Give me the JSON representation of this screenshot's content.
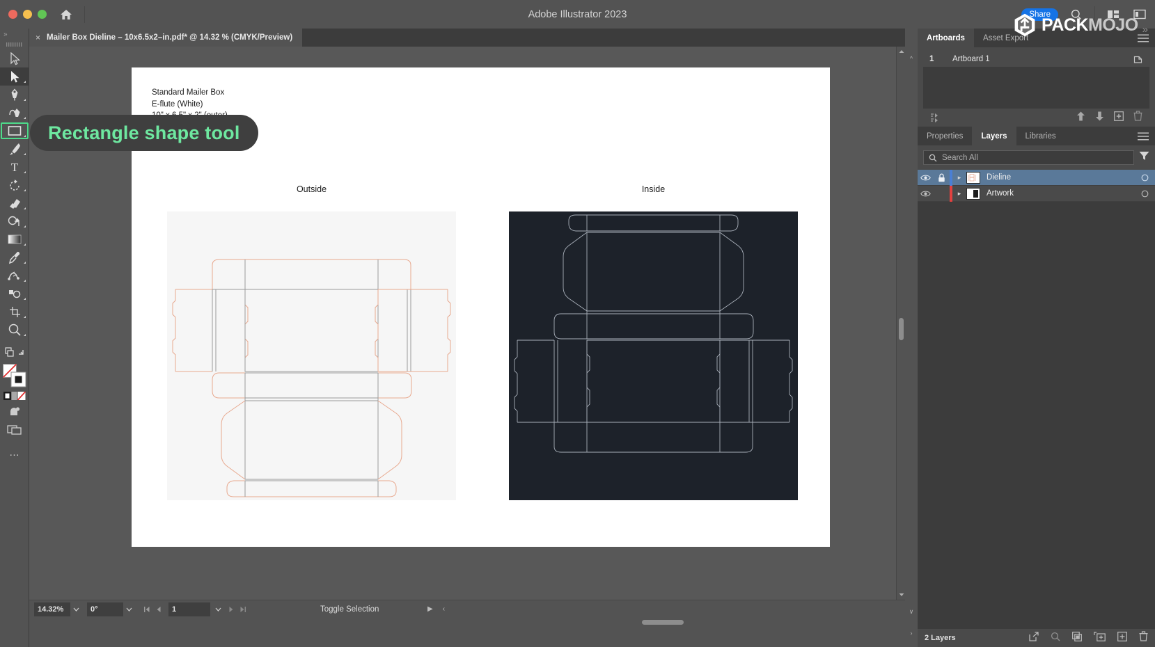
{
  "window": {
    "app_title": "Adobe Illustrator 2023",
    "traffic_lights": [
      "close-red",
      "minimize-yellow",
      "maximize-green"
    ],
    "home_icon": "home-icon",
    "share_label": "Share",
    "search_icon": "search-icon",
    "arrange_icon": "arrange-documents-icon",
    "workspace_icon": "workspace-switcher-icon"
  },
  "branding": {
    "logo_icon": "packmojo-cube-logo",
    "name_part1": "PACK",
    "name_part2": "MOJO",
    "trailing": "»"
  },
  "toolbar": {
    "collapse_label": "»",
    "tools": [
      {
        "name": "selection-tool",
        "icon": "arrow-outline-icon",
        "state": "normal"
      },
      {
        "name": "direct-selection-tool",
        "icon": "arrow-solid-icon",
        "state": "active"
      },
      {
        "name": "pen-tool",
        "icon": "pen-icon",
        "state": "normal"
      },
      {
        "name": "curvature-tool",
        "icon": "curvature-icon",
        "state": "normal"
      },
      {
        "name": "rectangle-shape-tool",
        "icon": "rectangle-icon",
        "state": "highlighted"
      },
      {
        "name": "paintbrush-tool",
        "icon": "paintbrush-icon",
        "state": "normal"
      },
      {
        "name": "type-tool",
        "icon": "type-T-icon",
        "state": "normal"
      },
      {
        "name": "rotate-tool",
        "icon": "rotate-icon",
        "state": "normal"
      },
      {
        "name": "eraser-tool",
        "icon": "eraser-icon",
        "state": "normal"
      },
      {
        "name": "shape-builder-tool",
        "icon": "shape-builder-icon",
        "state": "normal"
      },
      {
        "name": "gradient-tool",
        "icon": "gradient-icon",
        "state": "normal"
      },
      {
        "name": "eyedropper-tool",
        "icon": "eyedropper-icon",
        "state": "normal"
      },
      {
        "name": "blend-tool",
        "icon": "blend-icon",
        "state": "normal"
      },
      {
        "name": "symbol-sprayer-tool",
        "icon": "symbol-sprayer-icon",
        "state": "normal"
      },
      {
        "name": "artboard-tool",
        "icon": "artboard-icon",
        "state": "normal"
      },
      {
        "name": "zoom-tool",
        "icon": "magnifier-icon",
        "state": "normal"
      },
      {
        "name": "change-screen-mode",
        "icon": "screen-mode-icon",
        "state": "normal"
      },
      {
        "name": "edit-toolbar",
        "icon": "ellipsis-icon",
        "state": "normal"
      }
    ],
    "fill_stroke": {
      "fill_label": "none-fill",
      "stroke_label": "black-stroke",
      "color_mode_icons": [
        "color-swatch-icon",
        "gradient-swatch-icon",
        "none-swatch-icon"
      ]
    }
  },
  "tooltip": {
    "text": "Rectangle shape tool",
    "color": "#6ee8a0"
  },
  "document": {
    "tab_title": "Mailer Box Dieline – 10x6.5x2–in.pdf* @ 14.32 % (CMYK/Preview)",
    "tab_close": "×",
    "artboard_text": "Standard Mailer Box\nE-flute (White)\n10\" x 6.5\" x 2\" (outer)",
    "outside_label": "Outside",
    "inside_label": "Inside",
    "dieline_cut_color": "#e8a98f",
    "dieline_crease_color": "#9a9a9a",
    "inside_bg_color": "#1d222a",
    "inside_line_color": "#a9b0ba",
    "outside_bg_color": "#f6f6f6"
  },
  "statusbar": {
    "zoom_value": "14.32%",
    "rotation_value": "0°",
    "page_value": "1",
    "status_text": "Toggle Selection",
    "first_icon": "first-artboard-icon",
    "prev_icon": "previous-artboard-icon",
    "next_icon": "next-artboard-icon",
    "last_icon": "last-artboard-icon",
    "play_icon": "play-icon",
    "back_icon": "back-chevron-icon"
  },
  "panels": {
    "top_tabs": [
      {
        "label": "Artboards",
        "active": true,
        "name": "tab-artboards"
      },
      {
        "label": "Asset Export",
        "active": false,
        "name": "tab-asset-export"
      }
    ],
    "artboards": {
      "rows": [
        {
          "number": "1",
          "name": "Artboard 1",
          "icon": "artboard-options-icon"
        }
      ],
      "footer_icons": [
        "move-artboard-icon",
        "move-up-icon",
        "move-down-icon",
        "new-artboard-icon",
        "delete-artboard-icon"
      ]
    },
    "bottom_tabs": [
      {
        "label": "Properties",
        "active": false,
        "name": "tab-properties"
      },
      {
        "label": "Layers",
        "active": true,
        "name": "tab-layers"
      },
      {
        "label": "Libraries",
        "active": false,
        "name": "tab-libraries"
      }
    ],
    "layers": {
      "search_placeholder": "Search All",
      "filter_icon": "filter-funnel-icon",
      "rows": [
        {
          "name": "Dieline",
          "color": "#4a7fd4",
          "locked": true,
          "visible": true,
          "selected": true
        },
        {
          "name": "Artwork",
          "color": "#e2413f",
          "locked": false,
          "visible": true,
          "selected": false
        }
      ],
      "footer_count": "2 Layers",
      "footer_icons": [
        "release-to-layers-icon",
        "locate-object-icon",
        "make-clipping-mask-icon",
        "create-new-sublayer-icon",
        "create-new-layer-icon",
        "delete-selection-icon"
      ]
    },
    "menu_icon": "panel-menu-icon"
  }
}
